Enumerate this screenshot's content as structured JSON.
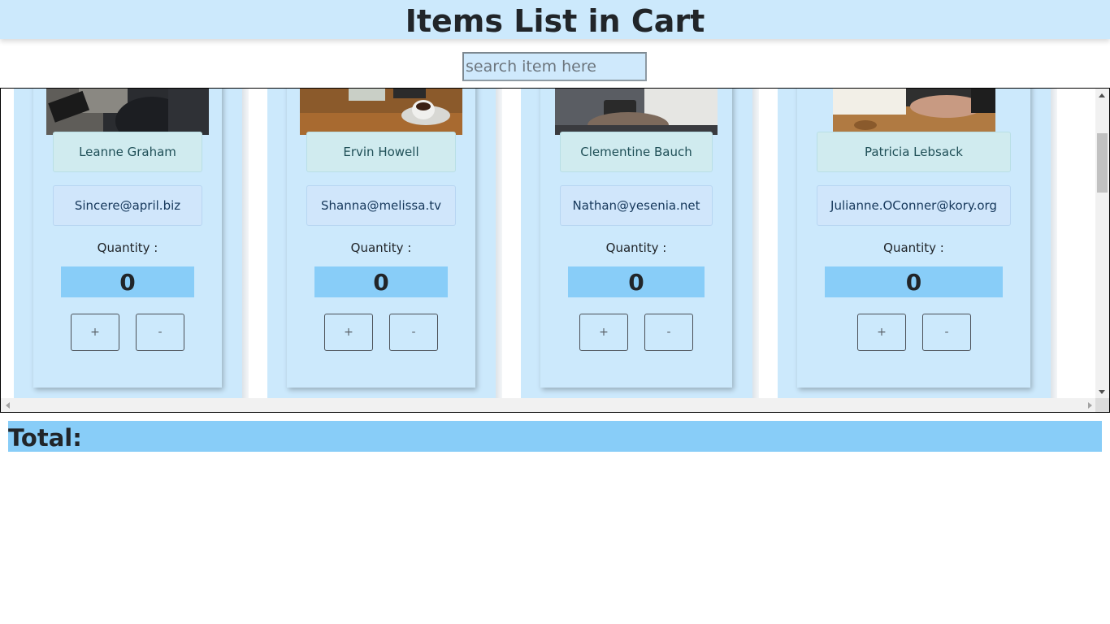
{
  "header": {
    "title": "Items List in Cart"
  },
  "search": {
    "placeholder": "search item here",
    "value": ""
  },
  "items": [
    {
      "name": "Leanne Graham",
      "email": "Sincere@april.biz",
      "quantity_label": "Quantity :",
      "quantity": "0",
      "plus_label": "+",
      "minus_label": "-"
    },
    {
      "name": "Ervin Howell",
      "email": "Shanna@melissa.tv",
      "quantity_label": "Quantity :",
      "quantity": "0",
      "plus_label": "+",
      "minus_label": "-"
    },
    {
      "name": "Clementine Bauch",
      "email": "Nathan@yesenia.net",
      "quantity_label": "Quantity :",
      "quantity": "0",
      "plus_label": "+",
      "minus_label": "-"
    },
    {
      "name": "Patricia Lebsack",
      "email": "Julianne.OConner@kory.org",
      "quantity_label": "Quantity :",
      "quantity": "0",
      "plus_label": "+",
      "minus_label": "-"
    }
  ],
  "footer": {
    "total_label": "Total:"
  },
  "colors": {
    "header_bg": "#cce9fc",
    "card_bg": "#cce9fc",
    "quantity_bg": "#88cdf8",
    "total_bg": "#88cdf8"
  }
}
